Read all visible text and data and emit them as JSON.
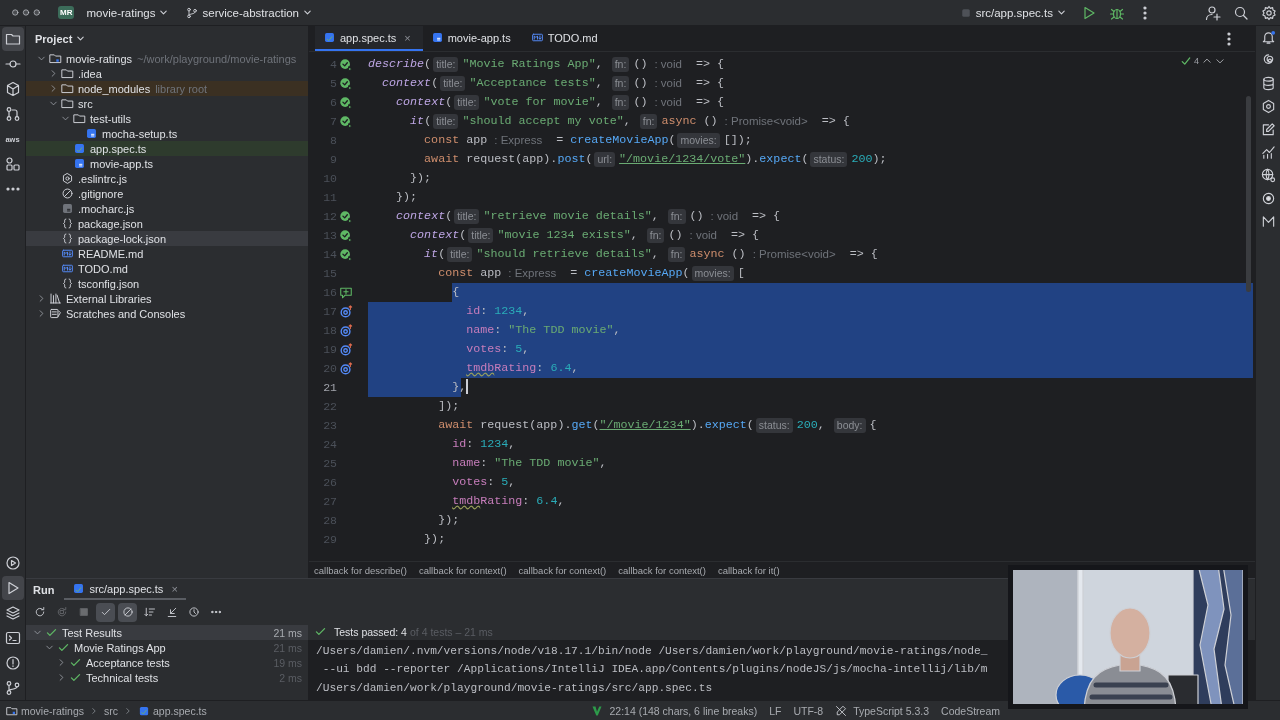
{
  "topbar": {
    "project_badge": "MR",
    "project": "movie-ratings",
    "branch": "service-abstraction",
    "run_config": "src/app.spec.ts"
  },
  "left_toolbar": {
    "top": [
      {
        "kind": "project",
        "selected": true
      },
      {
        "kind": "commit",
        "selected": false
      },
      {
        "kind": "cube",
        "selected": false
      },
      {
        "kind": "pull-requests",
        "selected": false
      },
      {
        "kind": "aws",
        "label": "aws",
        "selected": false
      },
      {
        "kind": "structure",
        "selected": false
      },
      {
        "kind": "more",
        "selected": false
      }
    ],
    "bottom": [
      {
        "kind": "services",
        "selected": false
      },
      {
        "kind": "run",
        "selected": true
      },
      {
        "kind": "layers",
        "selected": false
      },
      {
        "kind": "terminal",
        "selected": false
      },
      {
        "kind": "problems",
        "selected": false
      },
      {
        "kind": "git",
        "selected": false
      }
    ]
  },
  "right_toolbar": [
    {
      "kind": "notifications"
    },
    {
      "kind": "spiral"
    },
    {
      "kind": "database"
    },
    {
      "kind": "hexagon"
    },
    {
      "kind": "edit"
    },
    {
      "kind": "chart"
    },
    {
      "kind": "globe"
    },
    {
      "kind": "ring"
    },
    {
      "kind": "zigzag"
    }
  ],
  "project": {
    "title": "Project",
    "tree": [
      {
        "label": "movie-ratings",
        "kind": "module",
        "note": "~/work/playground/movie-ratings",
        "expanded": true,
        "selected": false,
        "children": [
          {
            "label": ".idea",
            "kind": "folder",
            "expanded": false,
            "selected": false
          },
          {
            "label": "node_modules",
            "kind": "library-folder",
            "note": "library root",
            "expanded": false,
            "selected": false
          },
          {
            "label": "src",
            "kind": "folder",
            "expanded": true,
            "selected": false,
            "children": [
              {
                "label": "test-utils",
                "kind": "folder",
                "expanded": true,
                "selected": false,
                "children": [
                  {
                    "label": "mocha-setup.ts",
                    "kind": "ts",
                    "selected": false
                  }
                ]
              },
              {
                "label": "app.spec.ts",
                "kind": "ts-test",
                "selected": false
              },
              {
                "label": "movie-app.ts",
                "kind": "ts",
                "selected": false
              }
            ]
          },
          {
            "label": ".eslintrc.js",
            "kind": "eslint",
            "selected": false
          },
          {
            "label": ".gitignore",
            "kind": "ignore",
            "selected": false
          },
          {
            "label": ".mocharc.js",
            "kind": "js",
            "selected": false
          },
          {
            "label": "package.json",
            "kind": "json",
            "selected": false
          },
          {
            "label": "package-lock.json",
            "kind": "json",
            "selected": true
          },
          {
            "label": "README.md",
            "kind": "md",
            "selected": false
          },
          {
            "label": "TODO.md",
            "kind": "md",
            "selected": false
          },
          {
            "label": "tsconfig.json",
            "kind": "json",
            "selected": false
          }
        ]
      },
      {
        "label": "External Libraries",
        "kind": "libraries",
        "expanded": false,
        "selected": false
      },
      {
        "label": "Scratches and Consoles",
        "kind": "scratches",
        "expanded": false,
        "selected": false
      }
    ]
  },
  "tabs": [
    {
      "label": "app.spec.ts",
      "kind": "ts-test",
      "selected": true,
      "close": "×"
    },
    {
      "label": "movie-app.ts",
      "kind": "ts",
      "selected": false
    },
    {
      "label": "TODO.md",
      "kind": "md",
      "selected": false
    }
  ],
  "editor": {
    "inspections": "4",
    "lines": [
      {
        "number": "4",
        "kind": "pass",
        "selected": false,
        "current": false,
        "tokens": [
          {
            "kind": "call",
            "text": "describe"
          },
          {
            "kind": "p",
            "text": "("
          },
          {
            "kind": "hint",
            "text": "title:"
          },
          {
            "kind": "str",
            "text": "\"Movie Ratings App\""
          },
          {
            "kind": "p",
            "text": ", "
          },
          {
            "kind": "hint",
            "text": "fn:"
          },
          {
            "kind": "p",
            "text": "() "
          },
          {
            "kind": "type",
            "text": ": void"
          },
          {
            "kind": "p",
            "text": "  => {"
          }
        ]
      },
      {
        "number": "5",
        "kind": "pass",
        "selected": false,
        "current": false,
        "tokens": [
          {
            "kind": "call",
            "text": "  context"
          },
          {
            "kind": "p",
            "text": "("
          },
          {
            "kind": "hint",
            "text": "title:"
          },
          {
            "kind": "str",
            "text": "\"Acceptance tests\""
          },
          {
            "kind": "p",
            "text": ", "
          },
          {
            "kind": "hint",
            "text": "fn:"
          },
          {
            "kind": "p",
            "text": "() "
          },
          {
            "kind": "type",
            "text": ": void"
          },
          {
            "kind": "p",
            "text": "  => {"
          }
        ]
      },
      {
        "number": "6",
        "kind": "pass",
        "selected": false,
        "current": false,
        "tokens": [
          {
            "kind": "call",
            "text": "    context"
          },
          {
            "kind": "p",
            "text": "("
          },
          {
            "kind": "hint",
            "text": "title:"
          },
          {
            "kind": "str",
            "text": "\"vote for movie\""
          },
          {
            "kind": "p",
            "text": ", "
          },
          {
            "kind": "hint",
            "text": "fn:"
          },
          {
            "kind": "p",
            "text": "() "
          },
          {
            "kind": "type",
            "text": ": void"
          },
          {
            "kind": "p",
            "text": "  => {"
          }
        ]
      },
      {
        "number": "7",
        "kind": "pass",
        "selected": false,
        "current": false,
        "tokens": [
          {
            "kind": "call",
            "text": "      it"
          },
          {
            "kind": "p",
            "text": "("
          },
          {
            "kind": "hint",
            "text": "title:"
          },
          {
            "kind": "str",
            "text": "\"should accept my vote\""
          },
          {
            "kind": "p",
            "text": ", "
          },
          {
            "kind": "hint",
            "text": "fn:"
          },
          {
            "kind": "kw",
            "text": "async"
          },
          {
            "kind": "p",
            "text": " () "
          },
          {
            "kind": "type",
            "text": ": Promise<void>"
          },
          {
            "kind": "p",
            "text": "  => {"
          }
        ]
      },
      {
        "number": "8",
        "kind": "plain",
        "selected": false,
        "current": false,
        "tokens": [
          {
            "kind": "kw",
            "text": "        const"
          },
          {
            "kind": "p",
            "text": " app "
          },
          {
            "kind": "type",
            "text": ": Express"
          },
          {
            "kind": "p",
            "text": "  = "
          },
          {
            "kind": "fn",
            "text": "createMovieApp"
          },
          {
            "kind": "p",
            "text": "("
          },
          {
            "kind": "hint",
            "text": "movies:"
          },
          {
            "kind": "p",
            "text": "[]);"
          }
        ]
      },
      {
        "number": "9",
        "kind": "plain",
        "selected": false,
        "current": false,
        "tokens": [
          {
            "kind": "kw",
            "text": "        await"
          },
          {
            "kind": "p",
            "text": " request(app)."
          },
          {
            "kind": "fn",
            "text": "post"
          },
          {
            "kind": "p",
            "text": "("
          },
          {
            "kind": "hint",
            "text": "url:"
          },
          {
            "kind": "url",
            "text": "\"/movie/1234/vote\""
          },
          {
            "kind": "p",
            "text": ")."
          },
          {
            "kind": "fn",
            "text": "expect"
          },
          {
            "kind": "p",
            "text": "("
          },
          {
            "kind": "hint",
            "text": "status:"
          },
          {
            "kind": "num",
            "text": "200"
          },
          {
            "kind": "p",
            "text": ");"
          }
        ]
      },
      {
        "number": "10",
        "kind": "plain",
        "selected": false,
        "current": false,
        "tokens": [
          {
            "kind": "p",
            "text": "      });"
          }
        ]
      },
      {
        "number": "11",
        "kind": "plain",
        "selected": false,
        "current": false,
        "tokens": [
          {
            "kind": "p",
            "text": "    });"
          }
        ]
      },
      {
        "number": "12",
        "kind": "pass",
        "selected": false,
        "current": false,
        "tokens": [
          {
            "kind": "call",
            "text": "    context"
          },
          {
            "kind": "p",
            "text": "("
          },
          {
            "kind": "hint",
            "text": "title:"
          },
          {
            "kind": "str",
            "text": "\"retrieve movie details\""
          },
          {
            "kind": "p",
            "text": ", "
          },
          {
            "kind": "hint",
            "text": "fn:"
          },
          {
            "kind": "p",
            "text": "() "
          },
          {
            "kind": "type",
            "text": ": void"
          },
          {
            "kind": "p",
            "text": "  => {"
          }
        ]
      },
      {
        "number": "13",
        "kind": "pass",
        "selected": false,
        "current": false,
        "tokens": [
          {
            "kind": "call",
            "text": "      context"
          },
          {
            "kind": "p",
            "text": "("
          },
          {
            "kind": "hint",
            "text": "title:"
          },
          {
            "kind": "str",
            "text": "\"movie 1234 exists\""
          },
          {
            "kind": "p",
            "text": ", "
          },
          {
            "kind": "hint",
            "text": "fn:"
          },
          {
            "kind": "p",
            "text": "() "
          },
          {
            "kind": "type",
            "text": ": void"
          },
          {
            "kind": "p",
            "text": "  => {"
          }
        ]
      },
      {
        "number": "14",
        "kind": "pass",
        "selected": false,
        "current": false,
        "tokens": [
          {
            "kind": "call",
            "text": "        it"
          },
          {
            "kind": "p",
            "text": "("
          },
          {
            "kind": "hint",
            "text": "title:"
          },
          {
            "kind": "str",
            "text": "\"should retrieve details\""
          },
          {
            "kind": "p",
            "text": ", "
          },
          {
            "kind": "hint",
            "text": "fn:"
          },
          {
            "kind": "kw",
            "text": "async"
          },
          {
            "kind": "p",
            "text": " () "
          },
          {
            "kind": "type",
            "text": ": Promise<void>"
          },
          {
            "kind": "p",
            "text": "  => {"
          }
        ]
      },
      {
        "number": "15",
        "kind": "plain",
        "selected": false,
        "current": false,
        "tokens": [
          {
            "kind": "kw",
            "text": "          const"
          },
          {
            "kind": "p",
            "text": " app "
          },
          {
            "kind": "type",
            "text": ": Express"
          },
          {
            "kind": "p",
            "text": "  = "
          },
          {
            "kind": "fn",
            "text": "createMovieApp"
          },
          {
            "kind": "p",
            "text": "("
          },
          {
            "kind": "hint",
            "text": "movies:"
          },
          {
            "kind": "p",
            "text": "["
          }
        ]
      },
      {
        "number": "16",
        "kind": "comment",
        "selected": true,
        "current": false,
        "tokens": [
          {
            "kind": "p",
            "text": "            {"
          }
        ]
      },
      {
        "number": "17",
        "kind": "target",
        "selected": true,
        "current": false,
        "tokens": [
          {
            "kind": "prop",
            "text": "              id"
          },
          {
            "kind": "p",
            "text": ": "
          },
          {
            "kind": "num",
            "text": "1234"
          },
          {
            "kind": "p",
            "text": ","
          }
        ]
      },
      {
        "number": "18",
        "kind": "target",
        "selected": true,
        "current": false,
        "tokens": [
          {
            "kind": "prop",
            "text": "              name"
          },
          {
            "kind": "p",
            "text": ": "
          },
          {
            "kind": "str",
            "text": "\"The TDD movie\""
          },
          {
            "kind": "p",
            "text": ","
          }
        ]
      },
      {
        "number": "19",
        "kind": "target",
        "selected": true,
        "current": false,
        "tokens": [
          {
            "kind": "prop",
            "text": "              votes"
          },
          {
            "kind": "p",
            "text": ": "
          },
          {
            "kind": "num",
            "text": "5"
          },
          {
            "kind": "p",
            "text": ","
          }
        ]
      },
      {
        "number": "20",
        "kind": "target",
        "selected": true,
        "current": false,
        "tokens": [
          {
            "kind": "typo",
            "text": "              tmdb"
          },
          {
            "kind": "prop",
            "text": "Rating"
          },
          {
            "kind": "p",
            "text": ": "
          },
          {
            "kind": "num",
            "text": "6.4"
          },
          {
            "kind": "p",
            "text": ","
          }
        ]
      },
      {
        "number": "21",
        "kind": "plain",
        "selected": true,
        "current": true,
        "tokens": [
          {
            "kind": "p",
            "text": "            },"
          }
        ]
      },
      {
        "number": "22",
        "kind": "plain",
        "selected": false,
        "current": false,
        "tokens": [
          {
            "kind": "p",
            "text": "          ]);"
          }
        ]
      },
      {
        "number": "23",
        "kind": "plain",
        "selected": false,
        "current": false,
        "tokens": [
          {
            "kind": "kw",
            "text": "          await"
          },
          {
            "kind": "p",
            "text": " request(app)."
          },
          {
            "kind": "fn",
            "text": "get"
          },
          {
            "kind": "p",
            "text": "("
          },
          {
            "kind": "url",
            "text": "\"/movie/1234\""
          },
          {
            "kind": "p",
            "text": ")."
          },
          {
            "kind": "fn",
            "text": "expect"
          },
          {
            "kind": "p",
            "text": "("
          },
          {
            "kind": "hint",
            "text": "status:"
          },
          {
            "kind": "num",
            "text": "200"
          },
          {
            "kind": "p",
            "text": ", "
          },
          {
            "kind": "hint",
            "text": "body:"
          },
          {
            "kind": "p",
            "text": "{"
          }
        ]
      },
      {
        "number": "24",
        "kind": "plain",
        "selected": false,
        "current": false,
        "tokens": [
          {
            "kind": "prop",
            "text": "            id"
          },
          {
            "kind": "p",
            "text": ": "
          },
          {
            "kind": "num",
            "text": "1234"
          },
          {
            "kind": "p",
            "text": ","
          }
        ]
      },
      {
        "number": "25",
        "kind": "plain",
        "selected": false,
        "current": false,
        "tokens": [
          {
            "kind": "prop",
            "text": "            name"
          },
          {
            "kind": "p",
            "text": ": "
          },
          {
            "kind": "str",
            "text": "\"The TDD movie\""
          },
          {
            "kind": "p",
            "text": ","
          }
        ]
      },
      {
        "number": "26",
        "kind": "plain",
        "selected": false,
        "current": false,
        "tokens": [
          {
            "kind": "prop",
            "text": "            votes"
          },
          {
            "kind": "p",
            "text": ": "
          },
          {
            "kind": "num",
            "text": "5"
          },
          {
            "kind": "p",
            "text": ","
          }
        ]
      },
      {
        "number": "27",
        "kind": "plain",
        "selected": false,
        "current": false,
        "tokens": [
          {
            "kind": "typo",
            "text": "            tmdb"
          },
          {
            "kind": "prop",
            "text": "Rating"
          },
          {
            "kind": "p",
            "text": ": "
          },
          {
            "kind": "num",
            "text": "6.4"
          },
          {
            "kind": "p",
            "text": ","
          }
        ]
      },
      {
        "number": "28",
        "kind": "plain",
        "selected": false,
        "current": false,
        "tokens": [
          {
            "kind": "p",
            "text": "          });"
          }
        ]
      },
      {
        "number": "29",
        "kind": "plain",
        "selected": false,
        "current": false,
        "tokens": [
          {
            "kind": "p",
            "text": "        });"
          }
        ]
      }
    ]
  },
  "breadcrumbs": [
    "callback for describe()",
    "callback for context()",
    "callback for context()",
    "callback for context()",
    "callback for it()"
  ],
  "run": {
    "title": "Run",
    "tab": {
      "label": "src/app.spec.ts",
      "close": "×",
      "selected": true
    },
    "toolbar": [
      {
        "kind": "rerun",
        "on": false,
        "disabled": false
      },
      {
        "kind": "rerun-failed",
        "on": false,
        "disabled": true
      },
      {
        "kind": "stop",
        "on": false,
        "disabled": true
      },
      {
        "kind": "show-passed",
        "on": true,
        "disabled": false
      },
      {
        "kind": "show-ignored",
        "on": true,
        "disabled": false
      },
      {
        "kind": "sort",
        "on": false,
        "disabled": false
      },
      {
        "kind": "collapse",
        "on": false,
        "disabled": false
      },
      {
        "kind": "history",
        "on": false,
        "disabled": false
      },
      {
        "kind": "more",
        "on": false,
        "disabled": false
      }
    ],
    "tests": [
      {
        "label": "Test Results",
        "time": "21 ms",
        "passed": true,
        "expanded": true,
        "selected": true,
        "children": [
          {
            "label": "Movie Ratings App",
            "time": "21 ms",
            "passed": true,
            "expanded": true,
            "selected": false,
            "children": [
              {
                "label": "Acceptance tests",
                "time": "19 ms",
                "passed": true,
                "expanded": false,
                "selected": false
              },
              {
                "label": "Technical tests",
                "time": "2 ms",
                "passed": true,
                "expanded": false,
                "selected": false
              }
            ]
          }
        ]
      }
    ],
    "summary": {
      "passed_all": true,
      "passed": "Tests passed: 4",
      "rest": "of 4 tests – 21 ms"
    },
    "console": [
      "/Users/damien/.nvm/versions/node/v18.17.1/bin/node /Users/damien/work/playground/movie-ratings/node_",
      " --ui bdd --reporter /Applications/IntelliJ IDEA.app/Contents/plugins/nodeJS/js/mocha-intellij/lib/m",
      "/Users/damien/work/playground/movie-ratings/src/app.spec.ts"
    ]
  },
  "status": {
    "path": [
      {
        "label": "movie-ratings",
        "kind": "module"
      },
      {
        "label": "src",
        "kind": "plain"
      },
      {
        "label": "app.spec.ts",
        "kind": "ts-test"
      }
    ],
    "items": [
      {
        "text": "22:14 (148 chars, 6 line breaks)",
        "kind": "position"
      },
      {
        "text": "LF",
        "kind": "line-ending"
      },
      {
        "text": "UTF-8",
        "kind": "encoding"
      },
      {
        "text": "TypeScript 5.3.3",
        "kind": "language"
      },
      {
        "text": "CodeStream",
        "kind": "plugin"
      }
    ]
  },
  "webcam": {
    "kind": "picture"
  }
}
